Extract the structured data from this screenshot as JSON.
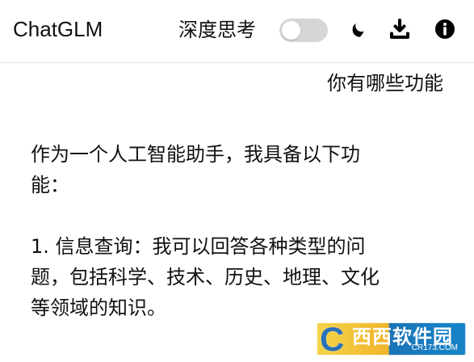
{
  "app": {
    "title": "ChatGLM"
  },
  "header": {
    "deep_think_label": "深度思考",
    "deep_think_enabled": false,
    "icons": {
      "theme": "moon-icon",
      "download": "download-icon",
      "info": "info-icon"
    }
  },
  "chat": {
    "user_message": "你有哪些功能",
    "assistant_lines": [
      "作为一个人工智能助手，我具备以下功",
      "能：",
      "",
      "1. 信息查询：我可以回答各种类型的问",
      "题，包括科学、技术、历史、地理、文化",
      "等领域的知识。"
    ]
  },
  "watermark": {
    "mark": "C",
    "main": "西西软件园",
    "sub": "CR173.COM",
    "colors": {
      "yellow": "#f0b52c",
      "blue": "#1684c8"
    }
  },
  "colors": {
    "background": "#ffffff",
    "text": "#111111",
    "toggle_off": "#d6d6d6",
    "divider": "#e6e6e6"
  }
}
